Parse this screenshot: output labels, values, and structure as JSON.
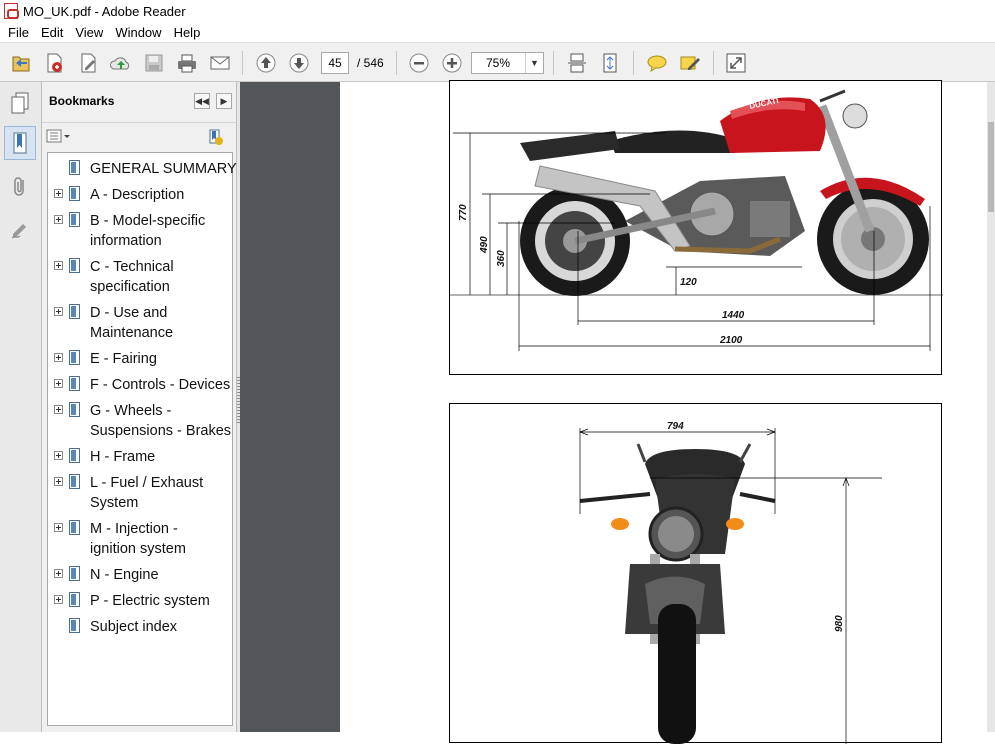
{
  "window": {
    "title": "MO_UK.pdf - Adobe Reader"
  },
  "menu": [
    "File",
    "Edit",
    "View",
    "Window",
    "Help"
  ],
  "toolbar": {
    "page_current": "45",
    "page_total": "/ 546",
    "zoom": "75%"
  },
  "bookmarks": {
    "title": "Bookmarks",
    "items": [
      {
        "label": "GENERAL SUMMARY",
        "expandable": false
      },
      {
        "label": "A - Description",
        "expandable": true
      },
      {
        "label": "B - Model-specific\ninformation",
        "expandable": true
      },
      {
        "label": "C - Technical\nspecification",
        "expandable": true
      },
      {
        "label": "D - Use and\nMaintenance",
        "expandable": true
      },
      {
        "label": "E - Fairing",
        "expandable": true
      },
      {
        "label": "F - Controls - Devices",
        "expandable": true
      },
      {
        "label": "G - Wheels -\nSuspensions - Brakes",
        "expandable": true
      },
      {
        "label": "H - Frame",
        "expandable": true
      },
      {
        "label": "L - Fuel / Exhaust\nSystem",
        "expandable": true
      },
      {
        "label": "M - Injection -\nignition system",
        "expandable": true
      },
      {
        "label": "N - Engine",
        "expandable": true
      },
      {
        "label": "P - Electric system",
        "expandable": true
      },
      {
        "label": "Subject index",
        "expandable": false
      }
    ]
  },
  "document": {
    "side_view_dims": {
      "height_total": "770",
      "seat": "490",
      "footpeg": "360",
      "ground_clearance": "120",
      "wheelbase": "1440",
      "length": "2100"
    },
    "front_view_dims": {
      "width": "794",
      "height": "980"
    },
    "brand_decal": "DUCATI"
  },
  "colors": {
    "tank_red": "#c8141c",
    "doc_background": "#525659"
  }
}
